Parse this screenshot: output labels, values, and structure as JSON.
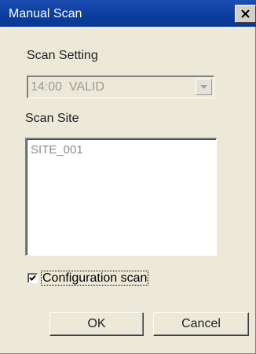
{
  "window": {
    "title": "Manual Scan",
    "close_icon": "close-icon",
    "title_bar_color": "#0a3c9c"
  },
  "scan_setting": {
    "label": "Scan Setting",
    "selected_value": "14:00  VALID",
    "disabled": true,
    "dropdown_icon": "chevron-down-icon"
  },
  "scan_site": {
    "label": "Scan Site",
    "items": [
      "SITE_001"
    ]
  },
  "configuration_scan": {
    "label": "Configuration scan",
    "checked": true
  },
  "buttons": {
    "ok_label": "OK",
    "cancel_label": "Cancel"
  }
}
